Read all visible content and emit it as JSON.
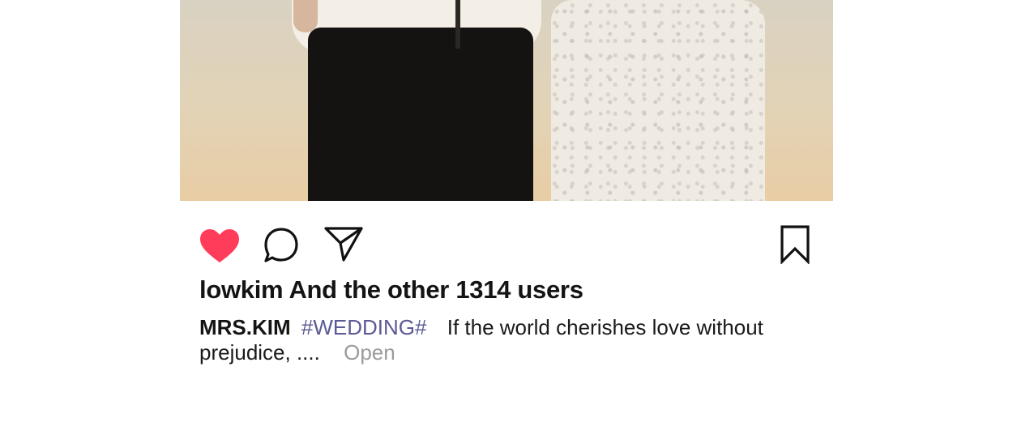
{
  "post": {
    "likes_text": "lowkim And the other 1314 users",
    "caption": {
      "username": "MRS.KIM",
      "hashtag": "#WEDDING#",
      "text": "If the world cherishes love without prejudice, ....",
      "more_label": "Open"
    }
  },
  "actions": {
    "like_icon": "heart-filled-icon",
    "comment_icon": "comment-bubble-icon",
    "share_icon": "paper-plane-icon",
    "save_icon": "bookmark-icon"
  },
  "colors": {
    "like_red": "#ff3d5a",
    "hashtag": "#5a5a96",
    "more_gray": "#9b9b9b",
    "text": "#141414"
  }
}
